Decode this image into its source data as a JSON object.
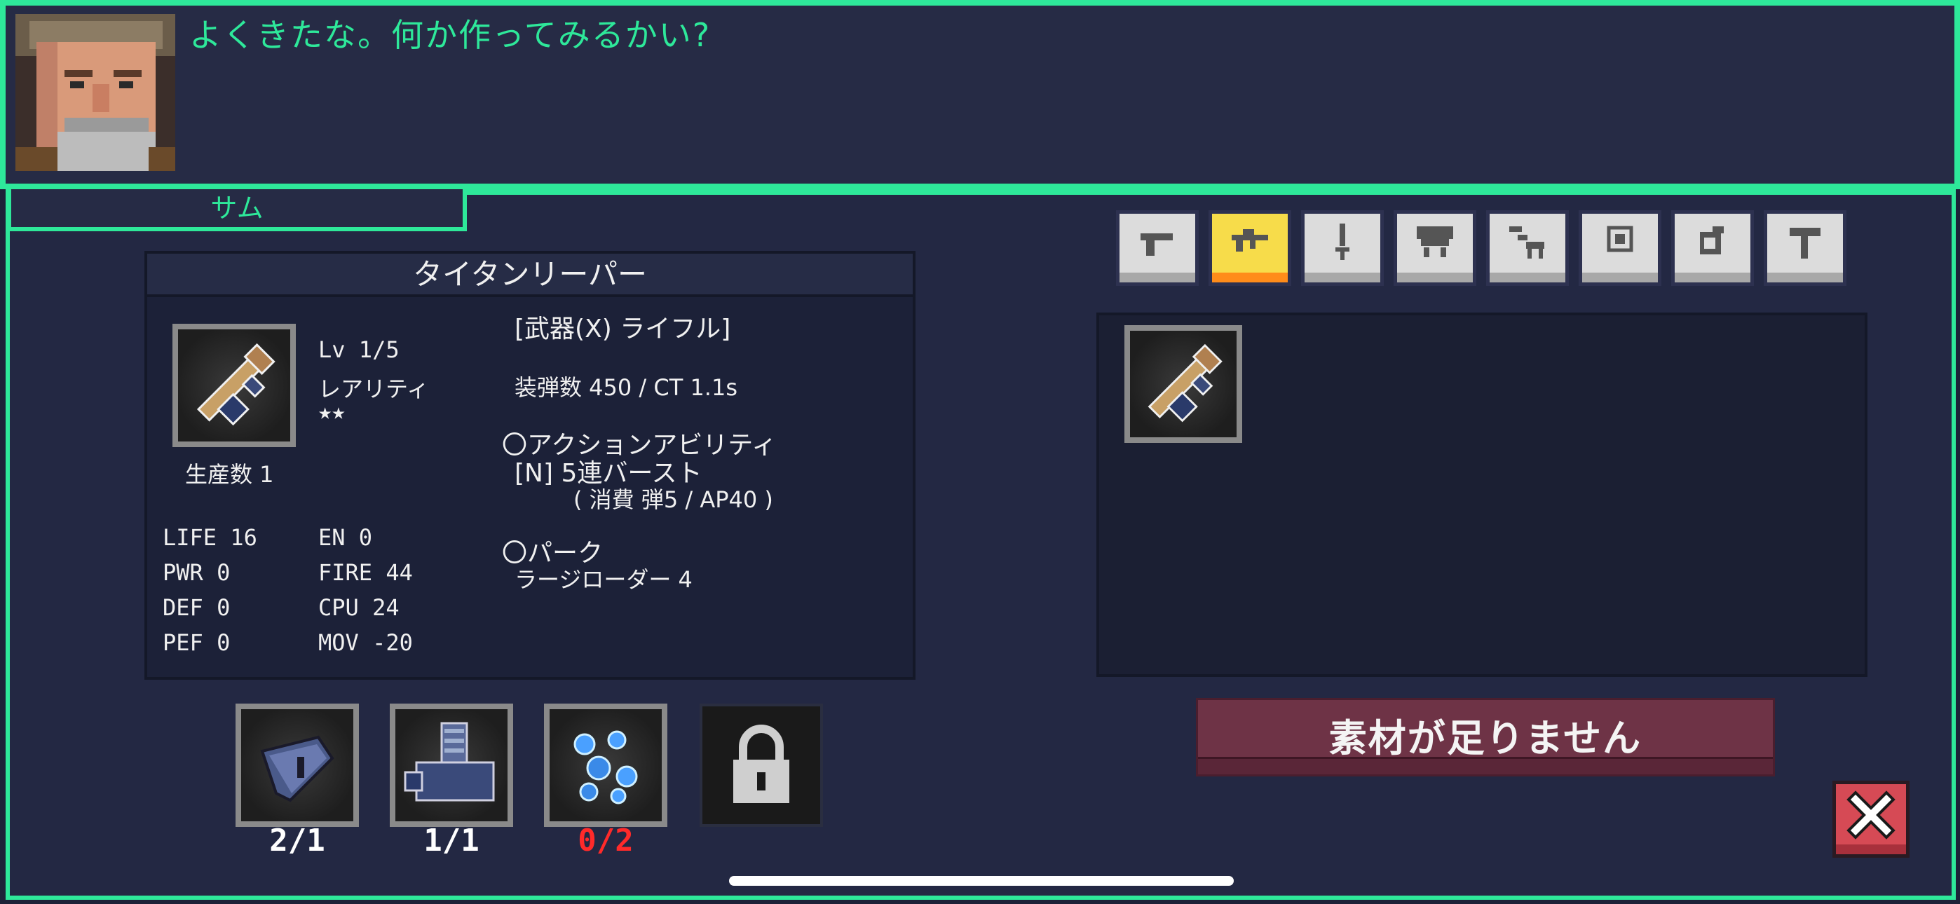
{
  "dialog": {
    "speaker": "サム",
    "text": "よくきたな。何か作ってみるかい?"
  },
  "item": {
    "name": "タイタンリーパー",
    "level": "Lv 1/5",
    "rarity_label": "レアリティ",
    "rarity_stars": "★★",
    "produced": "生産数 1",
    "category": "[武器(X) ライフル]",
    "ammo": "装弾数 450 / CT 1.1s",
    "action_header": "〇アクションアビリティ",
    "action_name": "[N] 5連バースト",
    "action_cost": "( 消費 弾5 / AP40 )",
    "perk_header": "〇パーク",
    "perk_name": "ラージローダー 4",
    "stats": {
      "life": "LIFE 16",
      "pwr": "PWR 0",
      "def": "DEF 0",
      "pef": "PEF 0",
      "en": "EN 0",
      "fire": "FIRE 44",
      "cpu": "CPU 24",
      "mov": "MOV -20"
    }
  },
  "materials": [
    {
      "icon": "armor-plate-icon",
      "count": "2/1",
      "sufficient": true
    },
    {
      "icon": "engine-part-icon",
      "count": "1/1",
      "sufficient": true
    },
    {
      "icon": "blue-crystal-icon",
      "count": "0/2",
      "sufficient": false
    },
    {
      "icon": "lock-icon",
      "count": "",
      "sufficient": null
    }
  ],
  "categories": [
    {
      "icon": "pistol-icon",
      "active": false
    },
    {
      "icon": "rifle-icon",
      "active": true
    },
    {
      "icon": "sword-icon",
      "active": false
    },
    {
      "icon": "heavy-weapon-icon",
      "active": false
    },
    {
      "icon": "drone-icon",
      "active": false
    },
    {
      "icon": "chip-icon",
      "active": false
    },
    {
      "icon": "armor-icon",
      "active": false
    },
    {
      "icon": "hammer-icon",
      "active": false
    }
  ],
  "craft_button": "素材が足りません",
  "colors": {
    "accent": "#2ee89a",
    "background": "#1d2238",
    "active_tab": "#f7dc4a",
    "insufficient": "#ff2a2a",
    "craft_button": "#6e3346",
    "close_button": "#d64a55"
  }
}
